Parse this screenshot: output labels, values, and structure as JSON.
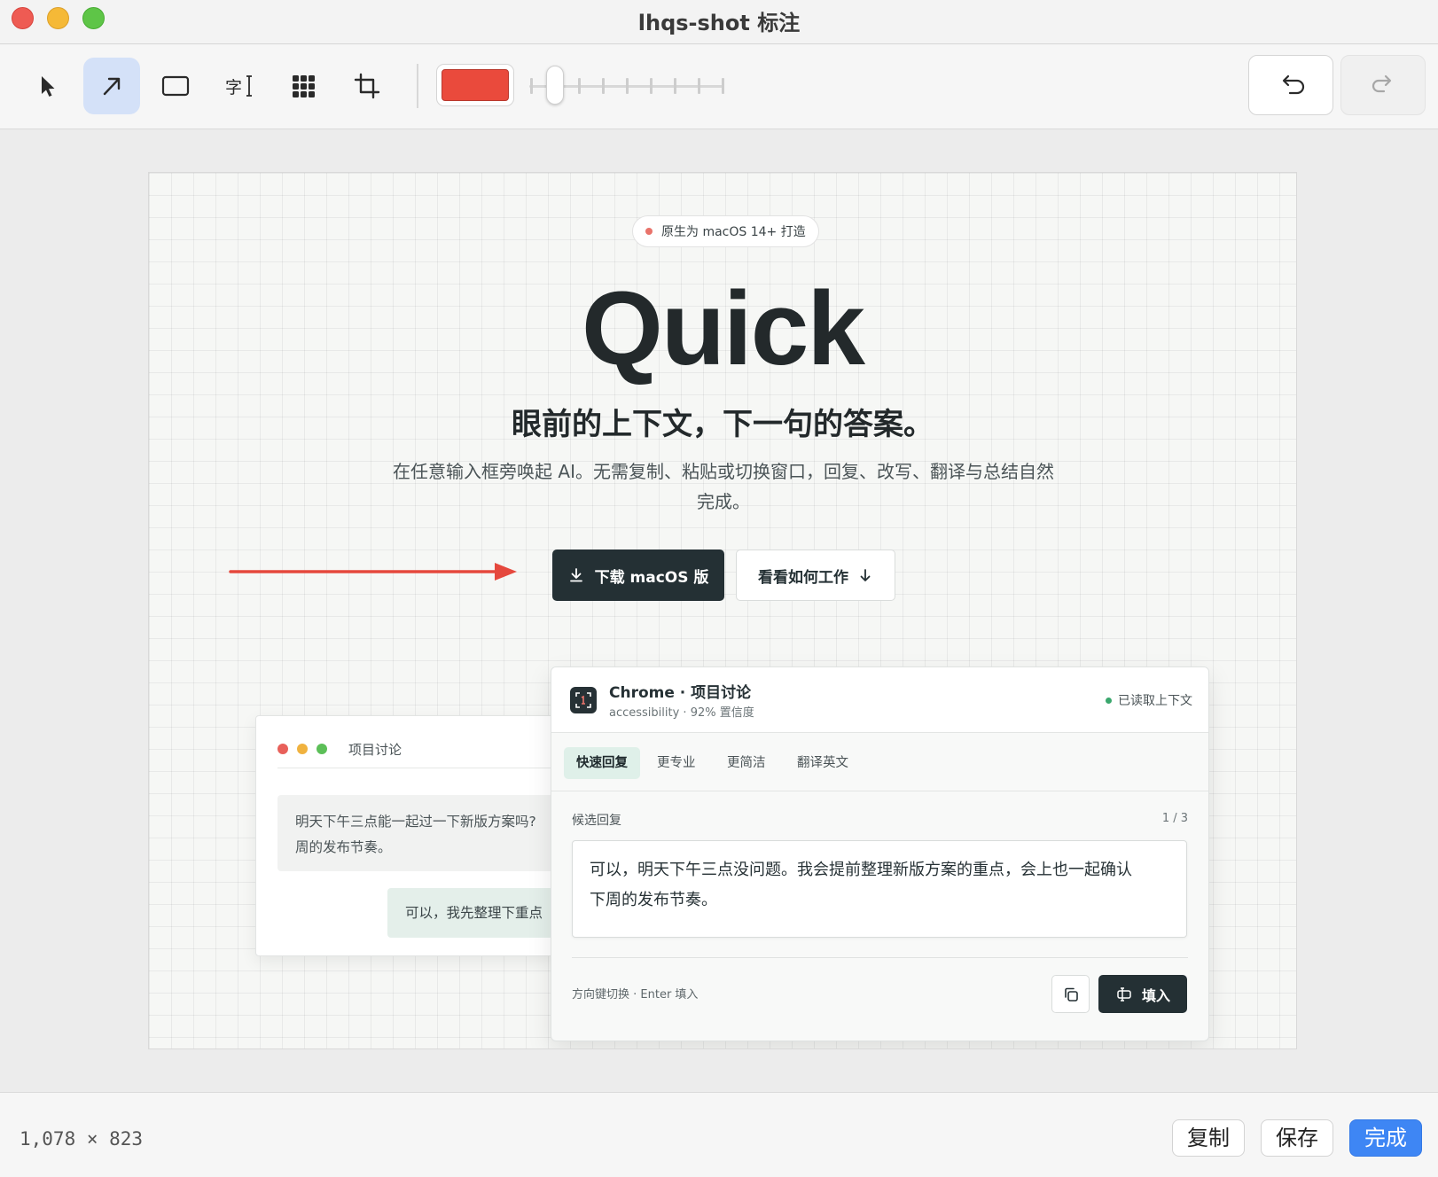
{
  "window": {
    "title": "lhqs-shot 标注"
  },
  "toolbar": {
    "tools": [
      {
        "name": "select",
        "icon": "cursor-icon",
        "active": false
      },
      {
        "name": "arrow",
        "icon": "arrow-tool-icon",
        "active": true
      },
      {
        "name": "rectangle",
        "icon": "rectangle-icon",
        "active": false
      },
      {
        "name": "text",
        "icon": "text-tool-icon",
        "glyph": "字",
        "active": false
      },
      {
        "name": "mosaic",
        "icon": "mosaic-grid-icon",
        "active": false
      },
      {
        "name": "crop",
        "icon": "crop-icon",
        "active": false
      }
    ],
    "color": "#ea4a3c",
    "stroke_level": 1,
    "stroke_levels": 9,
    "undo_icon": "undo-icon",
    "redo_icon": "redo-icon",
    "redo_enabled": false
  },
  "screenshot": {
    "badge": "原生为 macOS 14+ 打造",
    "hero_title": "Quick",
    "hero_subtitle": "眼前的上下文，下一句的答案。",
    "hero_desc_line1": "在任意输入框旁唤起 AI。无需复制、粘贴或切换窗口，回复、改写、翻译与总结自然",
    "hero_desc_line2": "完成。",
    "download_button": "下载 macOS 版",
    "how_button": "看看如何工作",
    "annotation_arrow_color": "#e5483d",
    "chat_window": {
      "title": "项目讨论",
      "incoming_line1": "明天下午三点能一起过一下新版方案吗?",
      "incoming_line2": "周的发布节奏。",
      "outgoing": "可以，我先整理下重点"
    },
    "panel": {
      "app_title": "Chrome · 项目讨论",
      "app_subtitle": "accessibility · 92% 置信度",
      "status": "已读取上下文",
      "tabs": [
        "快速回复",
        "更专业",
        "更简洁",
        "翻译英文"
      ],
      "active_tab": 0,
      "candidate_label": "候选回复",
      "candidate_count": "1 / 3",
      "reply_line1": "可以，明天下午三点没问题。我会提前整理新版方案的重点，会上也一起确认",
      "reply_line2": "下周的发布节奏。",
      "hint": "方向键切换 · Enter 填入",
      "fill_button": "填入"
    }
  },
  "bottombar": {
    "dimensions": "1,078 × 823",
    "copy_label": "复制",
    "save_label": "保存",
    "done_label": "完成"
  }
}
